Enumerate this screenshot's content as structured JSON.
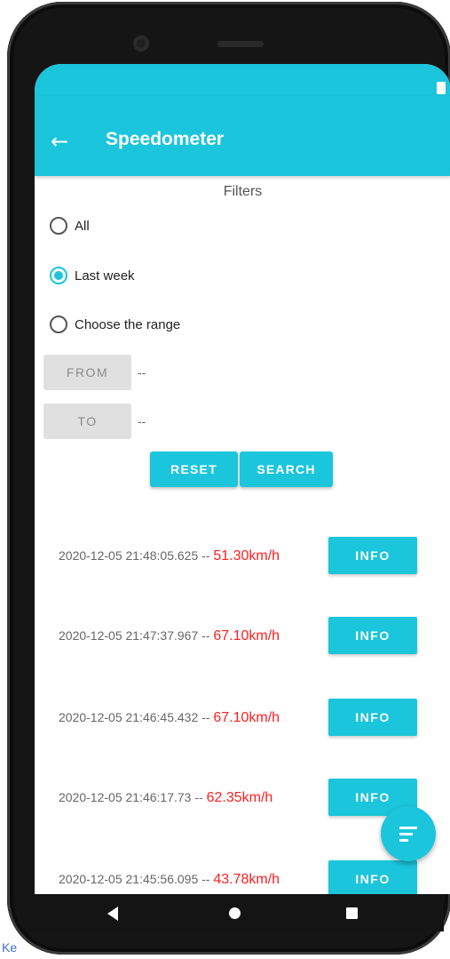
{
  "app": {
    "title": "Speedometer"
  },
  "filters": {
    "label": "Filters",
    "options": [
      {
        "label": "All",
        "checked": false
      },
      {
        "label": "Last week",
        "checked": true
      },
      {
        "label": "Choose the range",
        "checked": false
      }
    ],
    "from_label": "FROM",
    "from_value": "--",
    "to_label": "TO",
    "to_value": "--",
    "reset_label": "RESET",
    "search_label": "SEARCH"
  },
  "records": [
    {
      "timestamp": "2020-12-05 21:48:05.625",
      "separator": "--",
      "speed": "51.30km/h",
      "button": "INFO"
    },
    {
      "timestamp": "2020-12-05 21:47:37.967",
      "separator": "--",
      "speed": "67.10km/h",
      "button": "INFO"
    },
    {
      "timestamp": "2020-12-05 21:46:45.432",
      "separator": "--",
      "speed": "67.10km/h",
      "button": "INFO"
    },
    {
      "timestamp": "2020-12-05 21:46:17.73",
      "separator": "--",
      "speed": "62.35km/h",
      "button": "INFO"
    },
    {
      "timestamp": "2020-12-05 21:45:56.095",
      "separator": "--",
      "speed": "43.78km/h",
      "button": "INFO"
    }
  ],
  "icons": {
    "back": "arrow-left-icon",
    "fab": "filter-list-icon",
    "status": "battery-icon",
    "nav": [
      "nav-back-icon",
      "nav-home-icon",
      "nav-recents-icon"
    ]
  },
  "colors": {
    "accent": "#1bc5db",
    "speed": "#ff1e1e"
  },
  "corner_text": "Ke"
}
